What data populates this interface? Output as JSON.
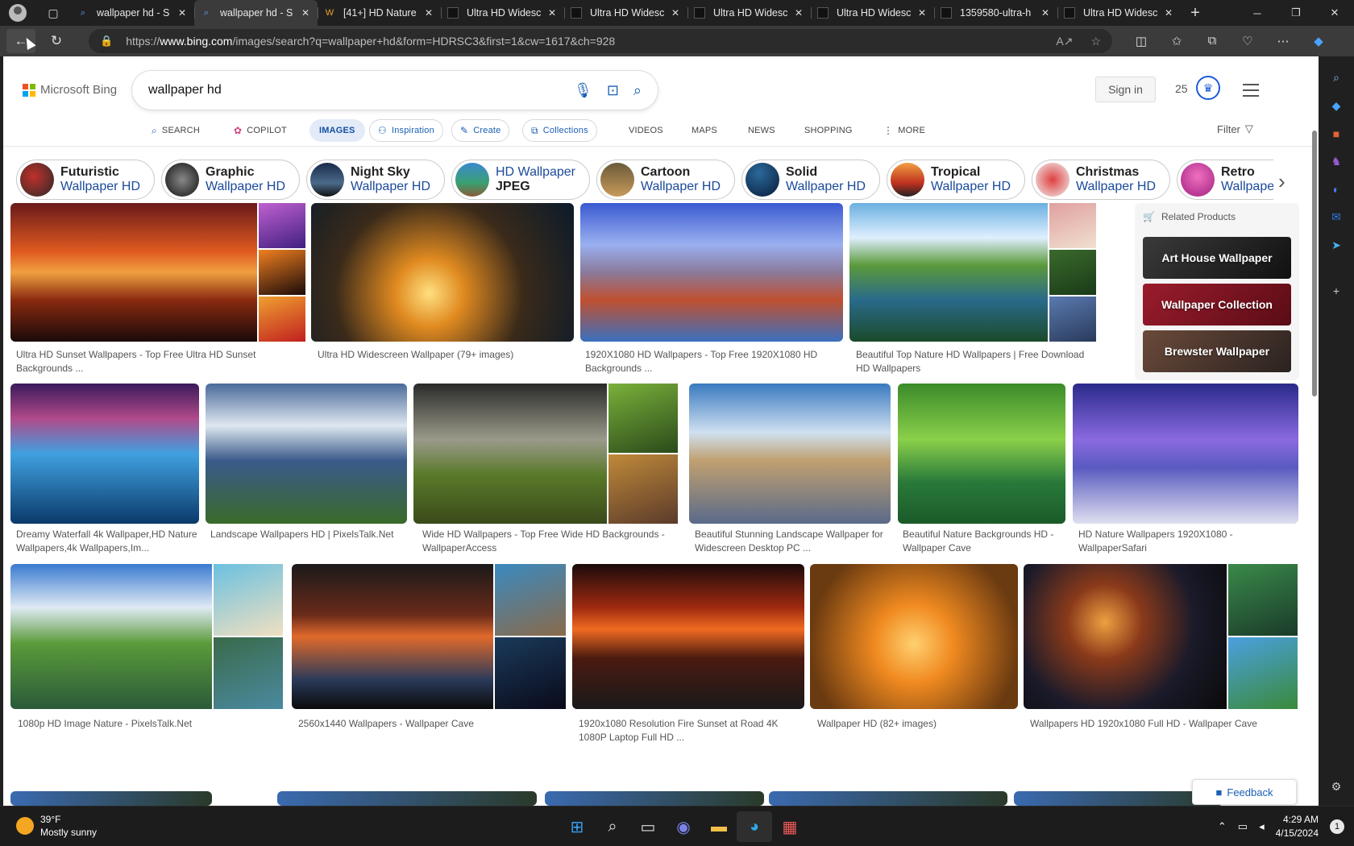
{
  "browser": {
    "tabs": [
      {
        "label": "wallpaper hd - S",
        "icon": "bing-search-icon",
        "active": false
      },
      {
        "label": "wallpaper hd - S",
        "icon": "bing-search-icon",
        "active": true
      },
      {
        "label": "[41+] HD Nature",
        "icon": "wallpapersafari-icon",
        "active": false
      },
      {
        "label": "Ultra HD Widesc",
        "icon": "page-icon",
        "active": false
      },
      {
        "label": "Ultra HD Widesc",
        "icon": "page-icon",
        "active": false
      },
      {
        "label": "Ultra HD Widesc",
        "icon": "page-icon",
        "active": false
      },
      {
        "label": "Ultra HD Widesc",
        "icon": "page-icon",
        "active": false
      },
      {
        "label": "1359580-ultra-h",
        "icon": "page-icon",
        "active": false
      },
      {
        "label": "Ultra HD Widesc",
        "icon": "page-icon",
        "active": false
      }
    ],
    "url_prefix": "https://",
    "url_host": "www.bing.com",
    "url_path": "/images/search?q=wallpaper+hd&form=HDRSC3&first=1&cw=1617&ch=928"
  },
  "bing": {
    "logo_text": "Microsoft Bing",
    "search_value": "wallpaper hd",
    "sign_in": "Sign in",
    "points": "25",
    "filter": "Filter",
    "scopes": {
      "search": "SEARCH",
      "copilot": "COPILOT",
      "images": "IMAGES",
      "inspiration": "Inspiration",
      "create": "Create",
      "collections": "Collections",
      "videos": "VIDEOS",
      "maps": "MAPS",
      "news": "NEWS",
      "shopping": "SHOPPING",
      "more": "MORE"
    },
    "chips": [
      {
        "line1": "Futuristic",
        "line2": "Wallpaper HD"
      },
      {
        "line1": "Graphic",
        "line2": "Wallpaper HD"
      },
      {
        "line1": "Night Sky",
        "line2": "Wallpaper HD"
      },
      {
        "line1": "HD Wallpaper",
        "line2": "JPEG"
      },
      {
        "line1": "Cartoon",
        "line2": "Wallpaper HD"
      },
      {
        "line1": "Solid",
        "line2": "Wallpaper HD"
      },
      {
        "line1": "Tropical",
        "line2": "Wallpaper HD"
      },
      {
        "line1": "Christmas",
        "line2": "Wallpaper HD"
      },
      {
        "line1": "Retro",
        "line2": "Wallpape"
      }
    ],
    "related": {
      "title": "Related Products",
      "items": [
        "Art House Wallpaper",
        "Wallpaper Collection",
        "Brewster Wallpaper"
      ]
    },
    "results": [
      "Ultra HD Sunset Wallpapers - Top Free Ultra HD Sunset Backgrounds ...",
      "Ultra HD Widescreen Wallpaper (79+ images)",
      "1920X1080 HD Wallpapers - Top Free 1920X1080 HD Backgrounds ...",
      "Beautiful Top Nature HD Wallpapers | Free Download HD Wallpapers",
      "Dreamy Waterfall 4k Wallpaper,HD Nature Wallpapers,4k Wallpapers,Im...",
      "Landscape Wallpapers HD | PixelsTalk.Net",
      "Wide HD Wallpapers - Top Free Wide HD Backgrounds - WallpaperAccess",
      "Beautiful Stunning Landscape Wallpaper for Widescreen Desktop PC ...",
      "Beautiful Nature Backgrounds HD - Wallpaper Cave",
      "HD Nature Wallpapers 1920X1080 - WallpaperSafari",
      "1080p HD Image Nature - PixelsTalk.Net",
      "2560x1440 Wallpapers - Wallpaper Cave",
      "1920x1080 Resolution Fire Sunset at Road 4K 1080P Laptop Full HD ...",
      "Wallpaper HD (82+ images)",
      "Wallpapers HD 1920x1080 Full HD - Wallpaper Cave"
    ],
    "feedback": "Feedback"
  },
  "taskbar": {
    "temp": "39°F",
    "condition": "Mostly sunny",
    "time": "4:29 AM",
    "date": "4/15/2024",
    "notifications": "1"
  }
}
